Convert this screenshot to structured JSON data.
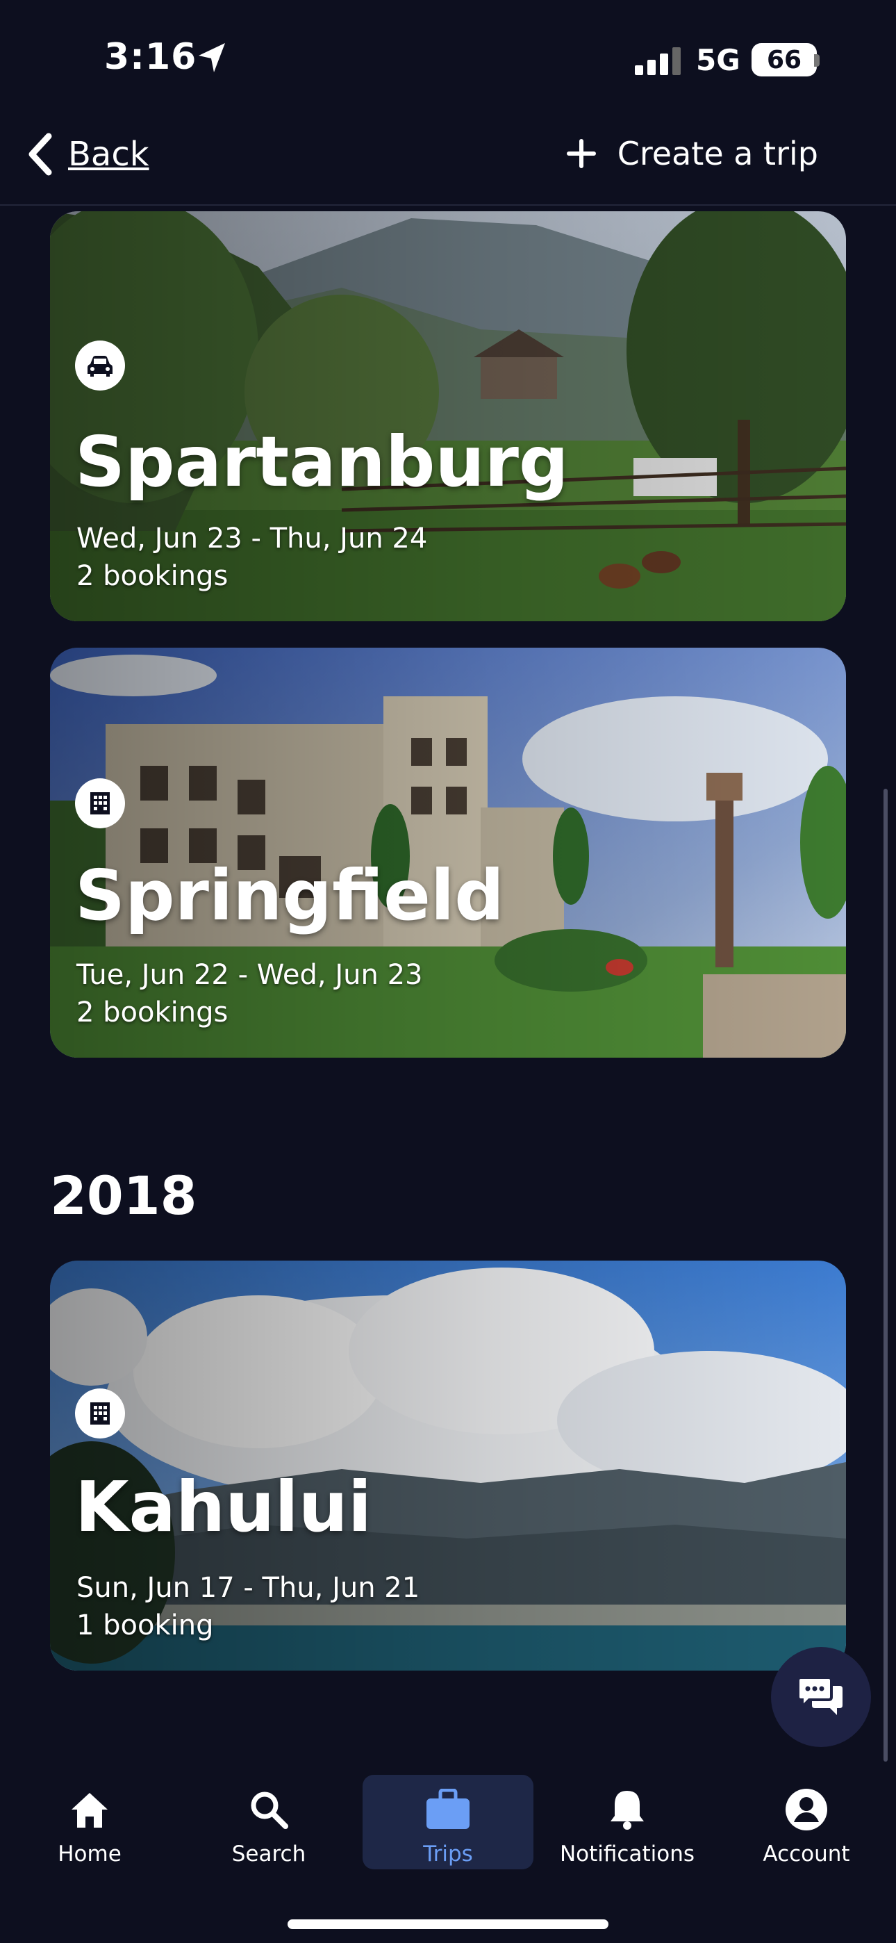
{
  "status_bar": {
    "time": "3:16",
    "network": "5G",
    "battery": "66"
  },
  "header": {
    "back_label": "Back",
    "create_label": "Create a trip"
  },
  "trips_2021": [
    {
      "city": "Spartanburg",
      "dates": "Wed, Jun 23 - Thu, Jun 24",
      "bookings": "2 bookings",
      "type_icon": "car-icon"
    },
    {
      "city": "Springfield",
      "dates": "Tue, Jun 22 - Wed, Jun 23",
      "bookings": "2 bookings",
      "type_icon": "hotel-icon"
    }
  ],
  "year_2018": "2018",
  "trips_2018": [
    {
      "city": "Kahului",
      "dates": "Sun, Jun 17 - Thu, Jun 21",
      "bookings": "1 booking",
      "type_icon": "hotel-icon"
    }
  ],
  "tabs": [
    {
      "label": "Home",
      "icon": "home-icon"
    },
    {
      "label": "Search",
      "icon": "search-icon"
    },
    {
      "label": "Trips",
      "icon": "briefcase-icon",
      "active": true
    },
    {
      "label": "Notifications",
      "icon": "bell-icon"
    },
    {
      "label": "Account",
      "icon": "account-icon"
    }
  ],
  "colors": {
    "background": "#0d0f1f",
    "active_tab": "#6b9ef5",
    "active_tab_bg": "#1e2747"
  }
}
